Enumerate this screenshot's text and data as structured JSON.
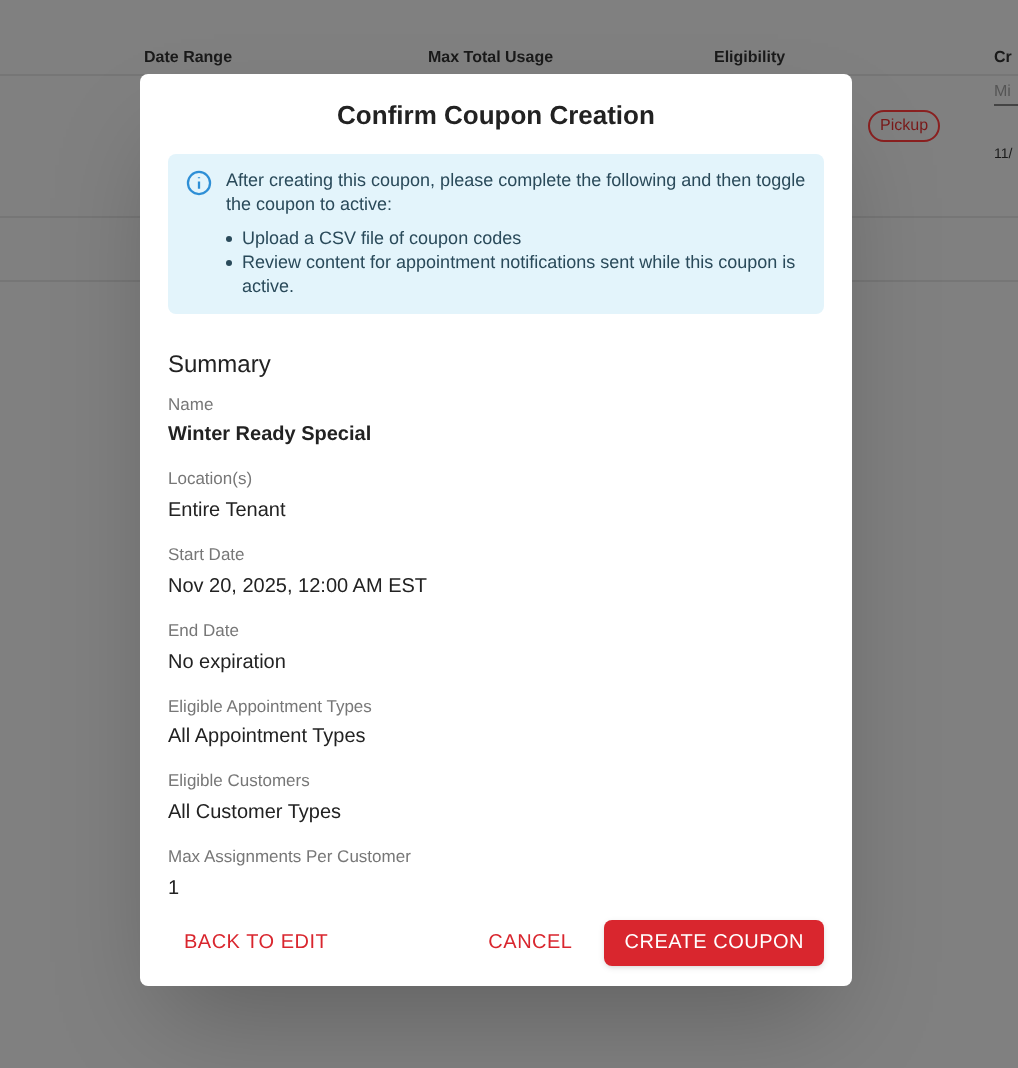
{
  "background": {
    "columns": [
      "Date Range",
      "Max Total Usage",
      "Eligibility",
      "Cr"
    ],
    "filter_field": {
      "placeholder": "Mi"
    },
    "row": {
      "tag": "Pickup",
      "date": "11/"
    }
  },
  "dialog": {
    "title": "Confirm Coupon Creation",
    "notice": {
      "text": "After creating this coupon, please complete the following and then toggle the coupon to active:",
      "items": [
        "Upload a CSV file of coupon codes",
        "Review content for appointment notifications sent while this coupon is active."
      ]
    },
    "summary_title": "Summary",
    "fields": [
      {
        "label": "Name",
        "value": "Winter Ready Special",
        "emphasis": true
      },
      {
        "label": "Location(s)",
        "value": "Entire Tenant",
        "emphasis": false
      },
      {
        "label": "Start Date",
        "value": "Nov 20, 2025, 12:00 AM EST",
        "emphasis": false
      },
      {
        "label": "End Date",
        "value": "No expiration",
        "emphasis": false
      },
      {
        "label": "Eligible Appointment Types",
        "value": "All Appointment Types",
        "emphasis": false
      },
      {
        "label": "Eligible Customers",
        "value": "All Customer Types",
        "emphasis": false
      },
      {
        "label": "Max Assignments Per Customer",
        "value": "1",
        "emphasis": false
      }
    ],
    "buttons": [
      {
        "label": "BACK TO EDIT",
        "kind": "text"
      },
      {
        "label": "CANCEL",
        "kind": "text"
      },
      {
        "label": "CREATE COUPON",
        "kind": "primary"
      }
    ]
  }
}
